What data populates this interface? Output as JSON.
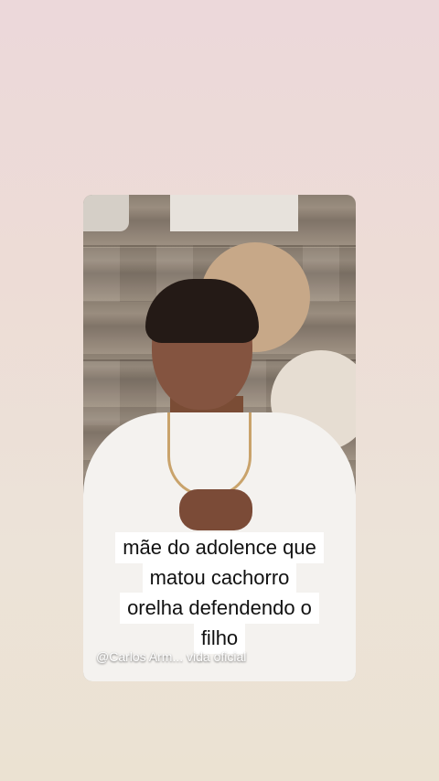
{
  "caption": {
    "lines": [
      "mãe do adolence que",
      "matou cachorro",
      "orelha defendendo o",
      "filho"
    ]
  },
  "watermark": "@Carlos Arm... vida oficial",
  "colors": {
    "background": "#ede0d8",
    "caption_bg": "#ffffff",
    "caption_text": "#111111"
  }
}
